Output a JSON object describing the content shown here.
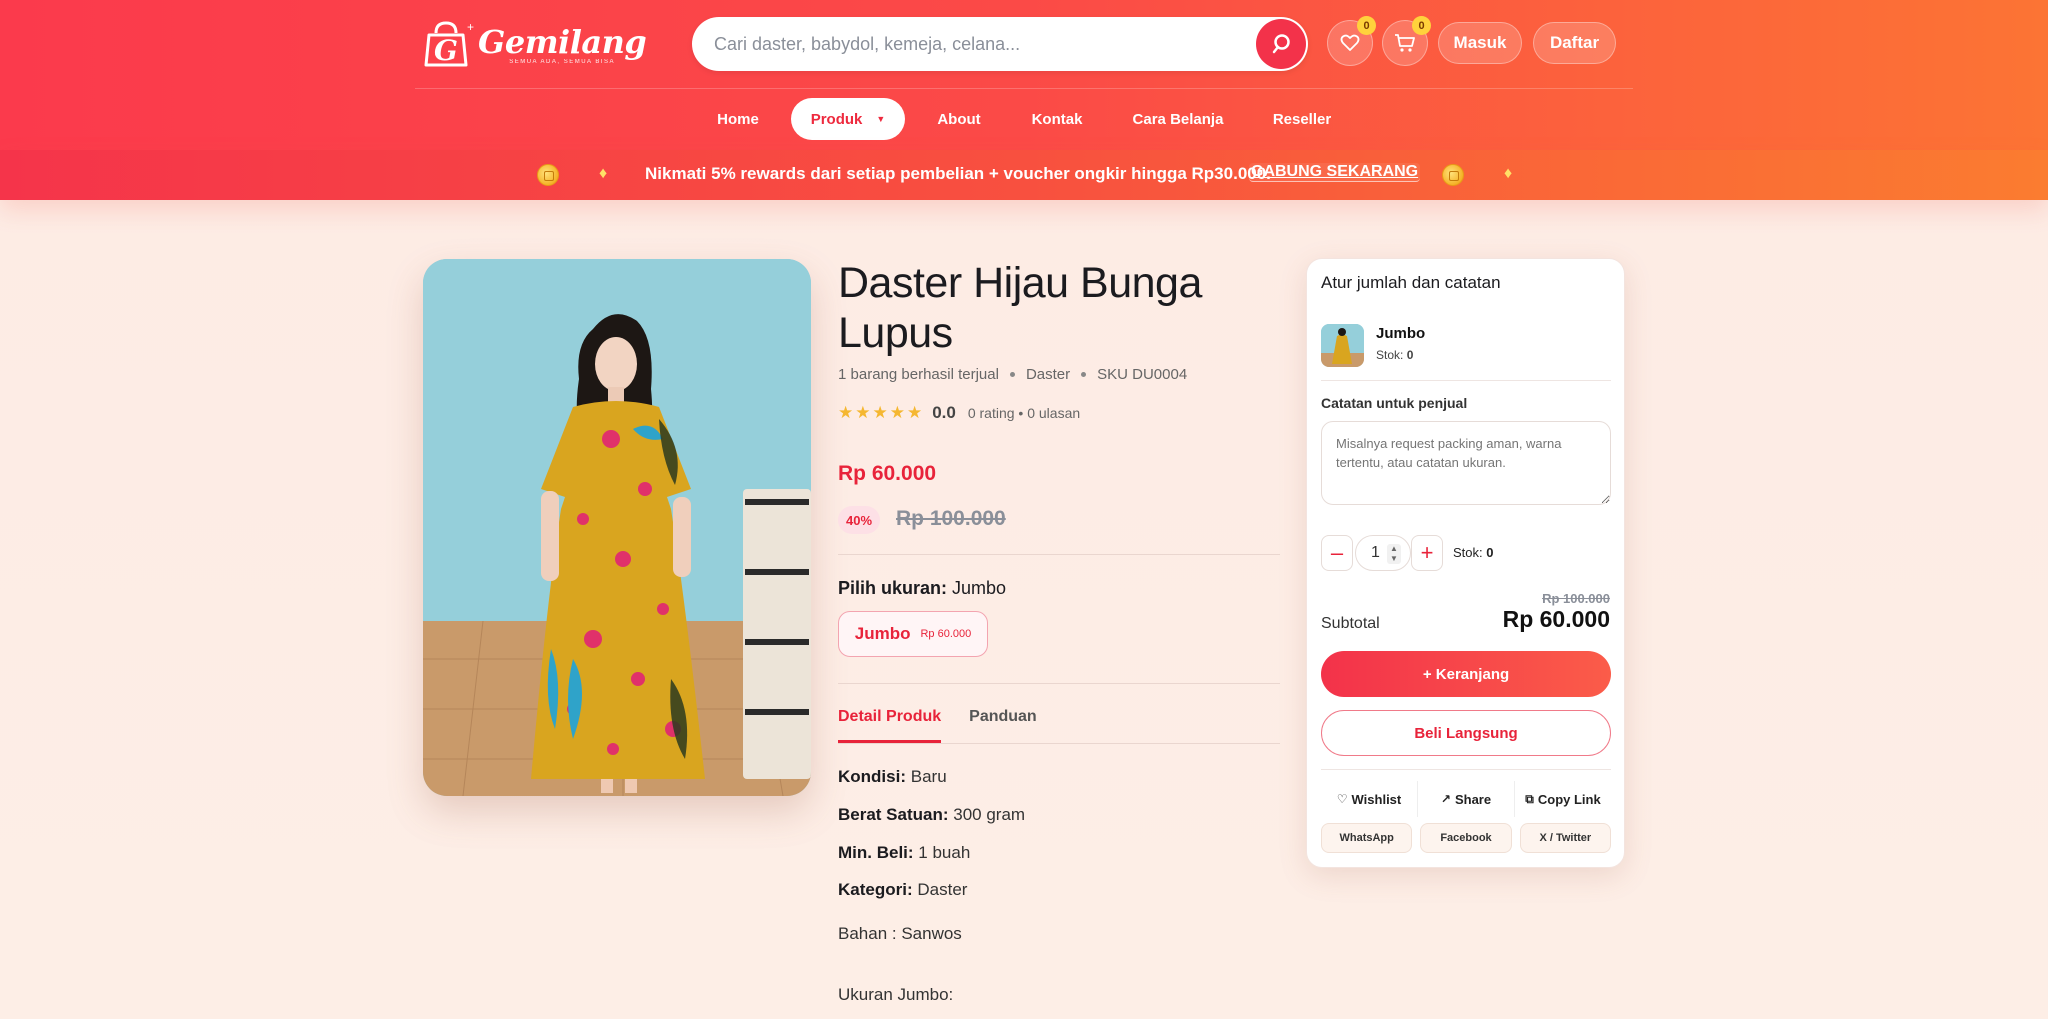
{
  "brand": {
    "name": "Gemilang",
    "tagline": "SEMUA ADA, SEMUA BISA"
  },
  "search": {
    "placeholder": "Cari daster, babydol, kemeja, celana...",
    "value": ""
  },
  "header": {
    "wishlist_count": "0",
    "cart_count": "0",
    "login_label": "Masuk",
    "register_label": "Daftar"
  },
  "nav": {
    "items": [
      {
        "label": "Home"
      },
      {
        "label": "Produk"
      },
      {
        "label": "About"
      },
      {
        "label": "Kontak"
      },
      {
        "label": "Cara Belanja"
      },
      {
        "label": "Reseller"
      }
    ],
    "active": "Produk"
  },
  "promo": {
    "text": "Nikmati 5% rewards dari setiap pembelian + voucher ongkir hingga Rp30.000.",
    "cta": "GABUNG SEKARANG"
  },
  "product": {
    "title": "Daster Hijau Bunga Lupus",
    "sold": "1 barang berhasil terjual",
    "category": "Daster",
    "sku": "SKU DU0004",
    "stars": "★★★★★",
    "rating": "0.0",
    "rating_text": "0 rating • 0 ulasan",
    "price": "Rp 60.000",
    "discount": "40%",
    "old_price": "Rp 100.000",
    "size_label": "Pilih ukuran:",
    "size_selected": "Jumbo",
    "size_option": {
      "name": "Jumbo",
      "price": "Rp 60.000"
    },
    "tabs": [
      {
        "label": "Detail Produk"
      },
      {
        "label": "Panduan"
      }
    ],
    "specs": [
      {
        "key": "Kondisi:",
        "value": "Baru"
      },
      {
        "key": "Berat Satuan:",
        "value": "300 gram"
      },
      {
        "key": "Min. Beli:",
        "value": "1 buah"
      },
      {
        "key": "Kategori:",
        "value": "Daster"
      }
    ],
    "desc_line1": "Bahan : Sanwos",
    "desc_line2": "Ukuran Jumbo:"
  },
  "cart_card": {
    "title": "Atur jumlah dan catatan",
    "variant_name": "Jumbo",
    "variant_stock_label": "Stok:",
    "variant_stock_value": "0",
    "note_label": "Catatan untuk penjual",
    "note_placeholder": "Misalnya request packing aman, warna tertentu, atau catatan ukuran.",
    "qty": "1",
    "stock_label": "Stok:",
    "stock_value": "0",
    "subtotal_label": "Subtotal",
    "subtotal_old": "Rp 100.000",
    "subtotal": "Rp 60.000",
    "add_cart": "+ Keranjang",
    "buy_now": "Beli Langsung",
    "wishlist": "Wishlist",
    "share": "Share",
    "copy_link": "Copy Link",
    "share_targets": [
      {
        "label": "WhatsApp"
      },
      {
        "label": "Facebook"
      },
      {
        "label": "X / Twitter"
      }
    ]
  },
  "colors": {
    "accent": "#e8233a",
    "header_start": "#fb3a4c",
    "header_end": "#fc7434",
    "background": "#fdebe4"
  }
}
